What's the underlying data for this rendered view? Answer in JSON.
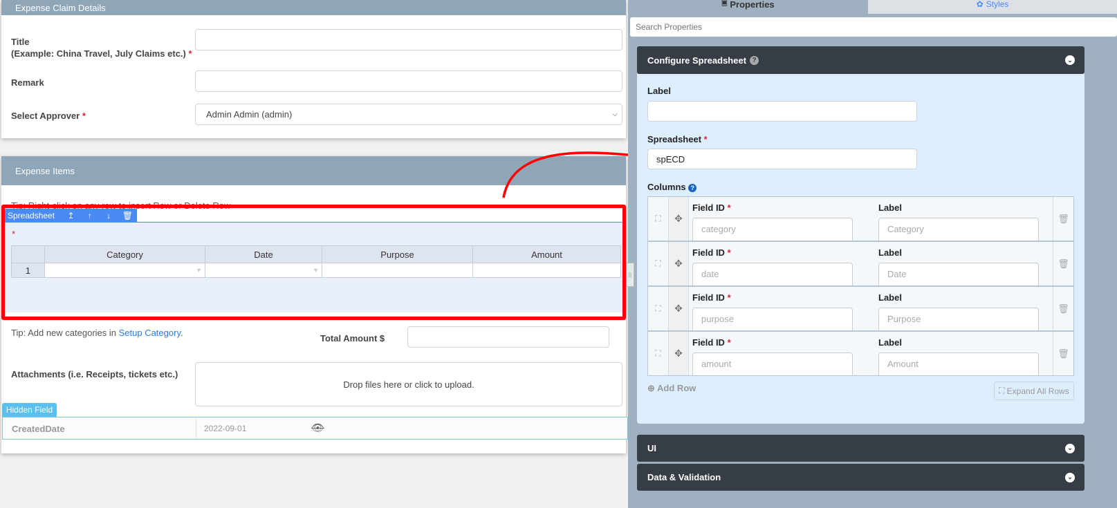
{
  "left": {
    "claim_card": {
      "title": "Expense Claim Details",
      "title_label": "Title",
      "title_hint": "(Example: China Travel, July Claims etc.)",
      "required": "*",
      "remark_label": "Remark",
      "approver_label": "Select Approver",
      "approver_value": "Admin Admin (admin)"
    },
    "items_card": {
      "title": "Expense Items",
      "tip": "Tip: Right-click on any row to insert Row or Delete Row",
      "toolbar_label": "Spreadsheet",
      "columns": [
        "Category",
        "Date",
        "Purpose",
        "Amount"
      ],
      "rows": [
        {
          "num": "1"
        }
      ],
      "tip2_prefix": "Tip: Add new categories in ",
      "tip2_link": "Setup Category",
      "tip2_suffix": ".",
      "total_label": "Total Amount $",
      "attach_label": "Attachments (i.e. Receipts, tickets etc.)",
      "drop_text": "Drop files here or click to upload.",
      "hidden_tag": "Hidden Field",
      "hidden_label": "CreatedDate",
      "hidden_value": "2022-09-01"
    }
  },
  "right": {
    "tabs": [
      {
        "label": "Properties",
        "icon": "file-icon"
      },
      {
        "label": "Styles",
        "icon": "palette-icon"
      }
    ],
    "search_placeholder": "Search Properties",
    "config": {
      "title": "Configure Spreadsheet",
      "label_label": "Label",
      "label_value": "",
      "spreadsheet_label": "Spreadsheet",
      "spreadsheet_value": "spECD",
      "columns_label": "Columns",
      "field_id_label": "Field ID",
      "col_label_label": "Label",
      "columns": [
        {
          "id": "category",
          "label": "Category"
        },
        {
          "id": "date",
          "label": "Date"
        },
        {
          "id": "purpose",
          "label": "Purpose"
        },
        {
          "id": "amount",
          "label": "Amount"
        }
      ],
      "add_row": "Add Row",
      "expand_all": "Expand All Rows"
    },
    "sections": [
      "UI",
      "Data & Validation"
    ]
  },
  "colors": {
    "accent": "#4a8af4",
    "highlight": "#ff0000",
    "panel_dark": "#363d45"
  }
}
